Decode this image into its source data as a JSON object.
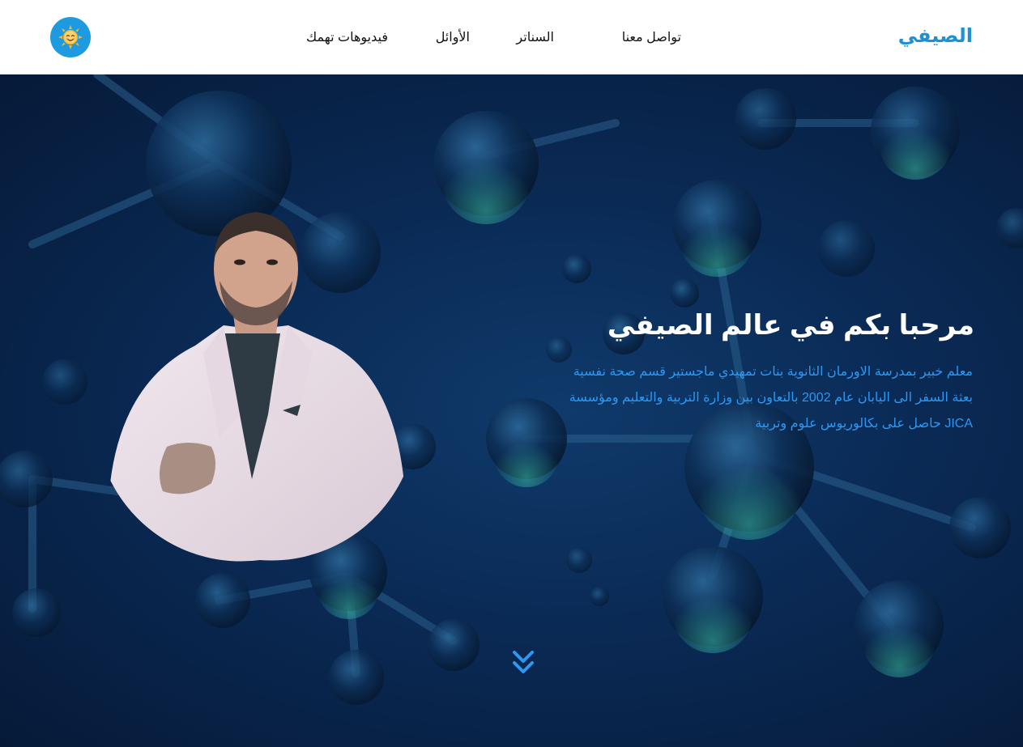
{
  "brand": {
    "name": "الصيفي",
    "color": "#1e90d6"
  },
  "nav": {
    "items": [
      {
        "label": "فيديوهات تهمك"
      },
      {
        "label": "الأوائل"
      },
      {
        "label": "السناتر"
      },
      {
        "label": "تواصل معنا"
      }
    ]
  },
  "theme_toggle": {
    "icon": "smiling-sun-icon",
    "color": "#1e9be0"
  },
  "hero": {
    "title": "مرحبا بكم في عالم الصيفي",
    "description": "معلم خبير بمدرسة الاورمان الثانوية بنات تمهيدي ماجستير قسم صحة نفسية بعثة السفر الى اليابان عام 2002 بالتعاون بين وزارة التربية والتعليم ومؤسسة JICA حاصل على بكالوريوس علوم وتربية",
    "text_color": "#2f97f0",
    "background": "#0a2a55",
    "portrait": "teacher-portrait",
    "scroll_icon": "double-chevron-down-icon"
  }
}
